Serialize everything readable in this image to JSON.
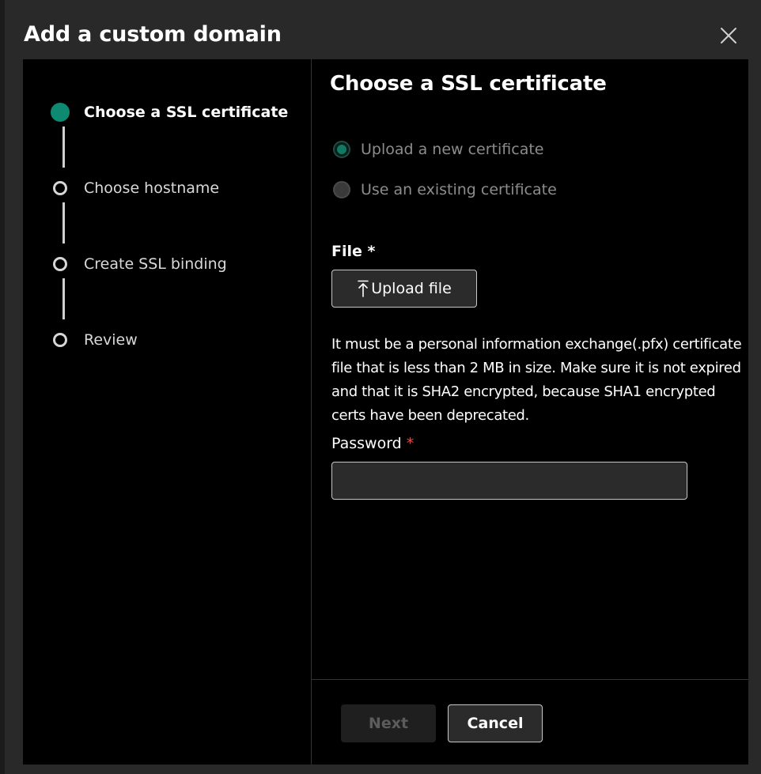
{
  "dialog": {
    "title": "Add a custom domain",
    "close_icon": "close-icon"
  },
  "steps": [
    {
      "label": "Choose a SSL certificate",
      "state": "active"
    },
    {
      "label": "Choose hostname",
      "state": "pending"
    },
    {
      "label": "Create SSL binding",
      "state": "pending"
    },
    {
      "label": "Review",
      "state": "pending"
    }
  ],
  "main": {
    "title": "Choose a SSL certificate",
    "certificate_options": [
      {
        "label": "Upload a new certificate",
        "checked": true,
        "disabled": true
      },
      {
        "label": "Use an existing certificate",
        "checked": false,
        "disabled": true
      }
    ],
    "file_label": "File *",
    "upload_button_label": "Upload file",
    "upload_icon": "upload-icon",
    "description": "It must be a personal information exchange(.pfx) certificate file that is less than 2 MB in size. Make sure it is not expired and that it is SHA2 encrypted, because SHA1 encrypted certs have been deprecated.",
    "password_label": "Password",
    "password_required_mark": "*",
    "password_value": "",
    "password_placeholder": ""
  },
  "footer": {
    "next_label": "Next",
    "cancel_label": "Cancel"
  },
  "colors": {
    "accent": "#0e8a73",
    "required": "#e04f4f",
    "dialog_background": "#292929",
    "content_background": "#000000"
  }
}
